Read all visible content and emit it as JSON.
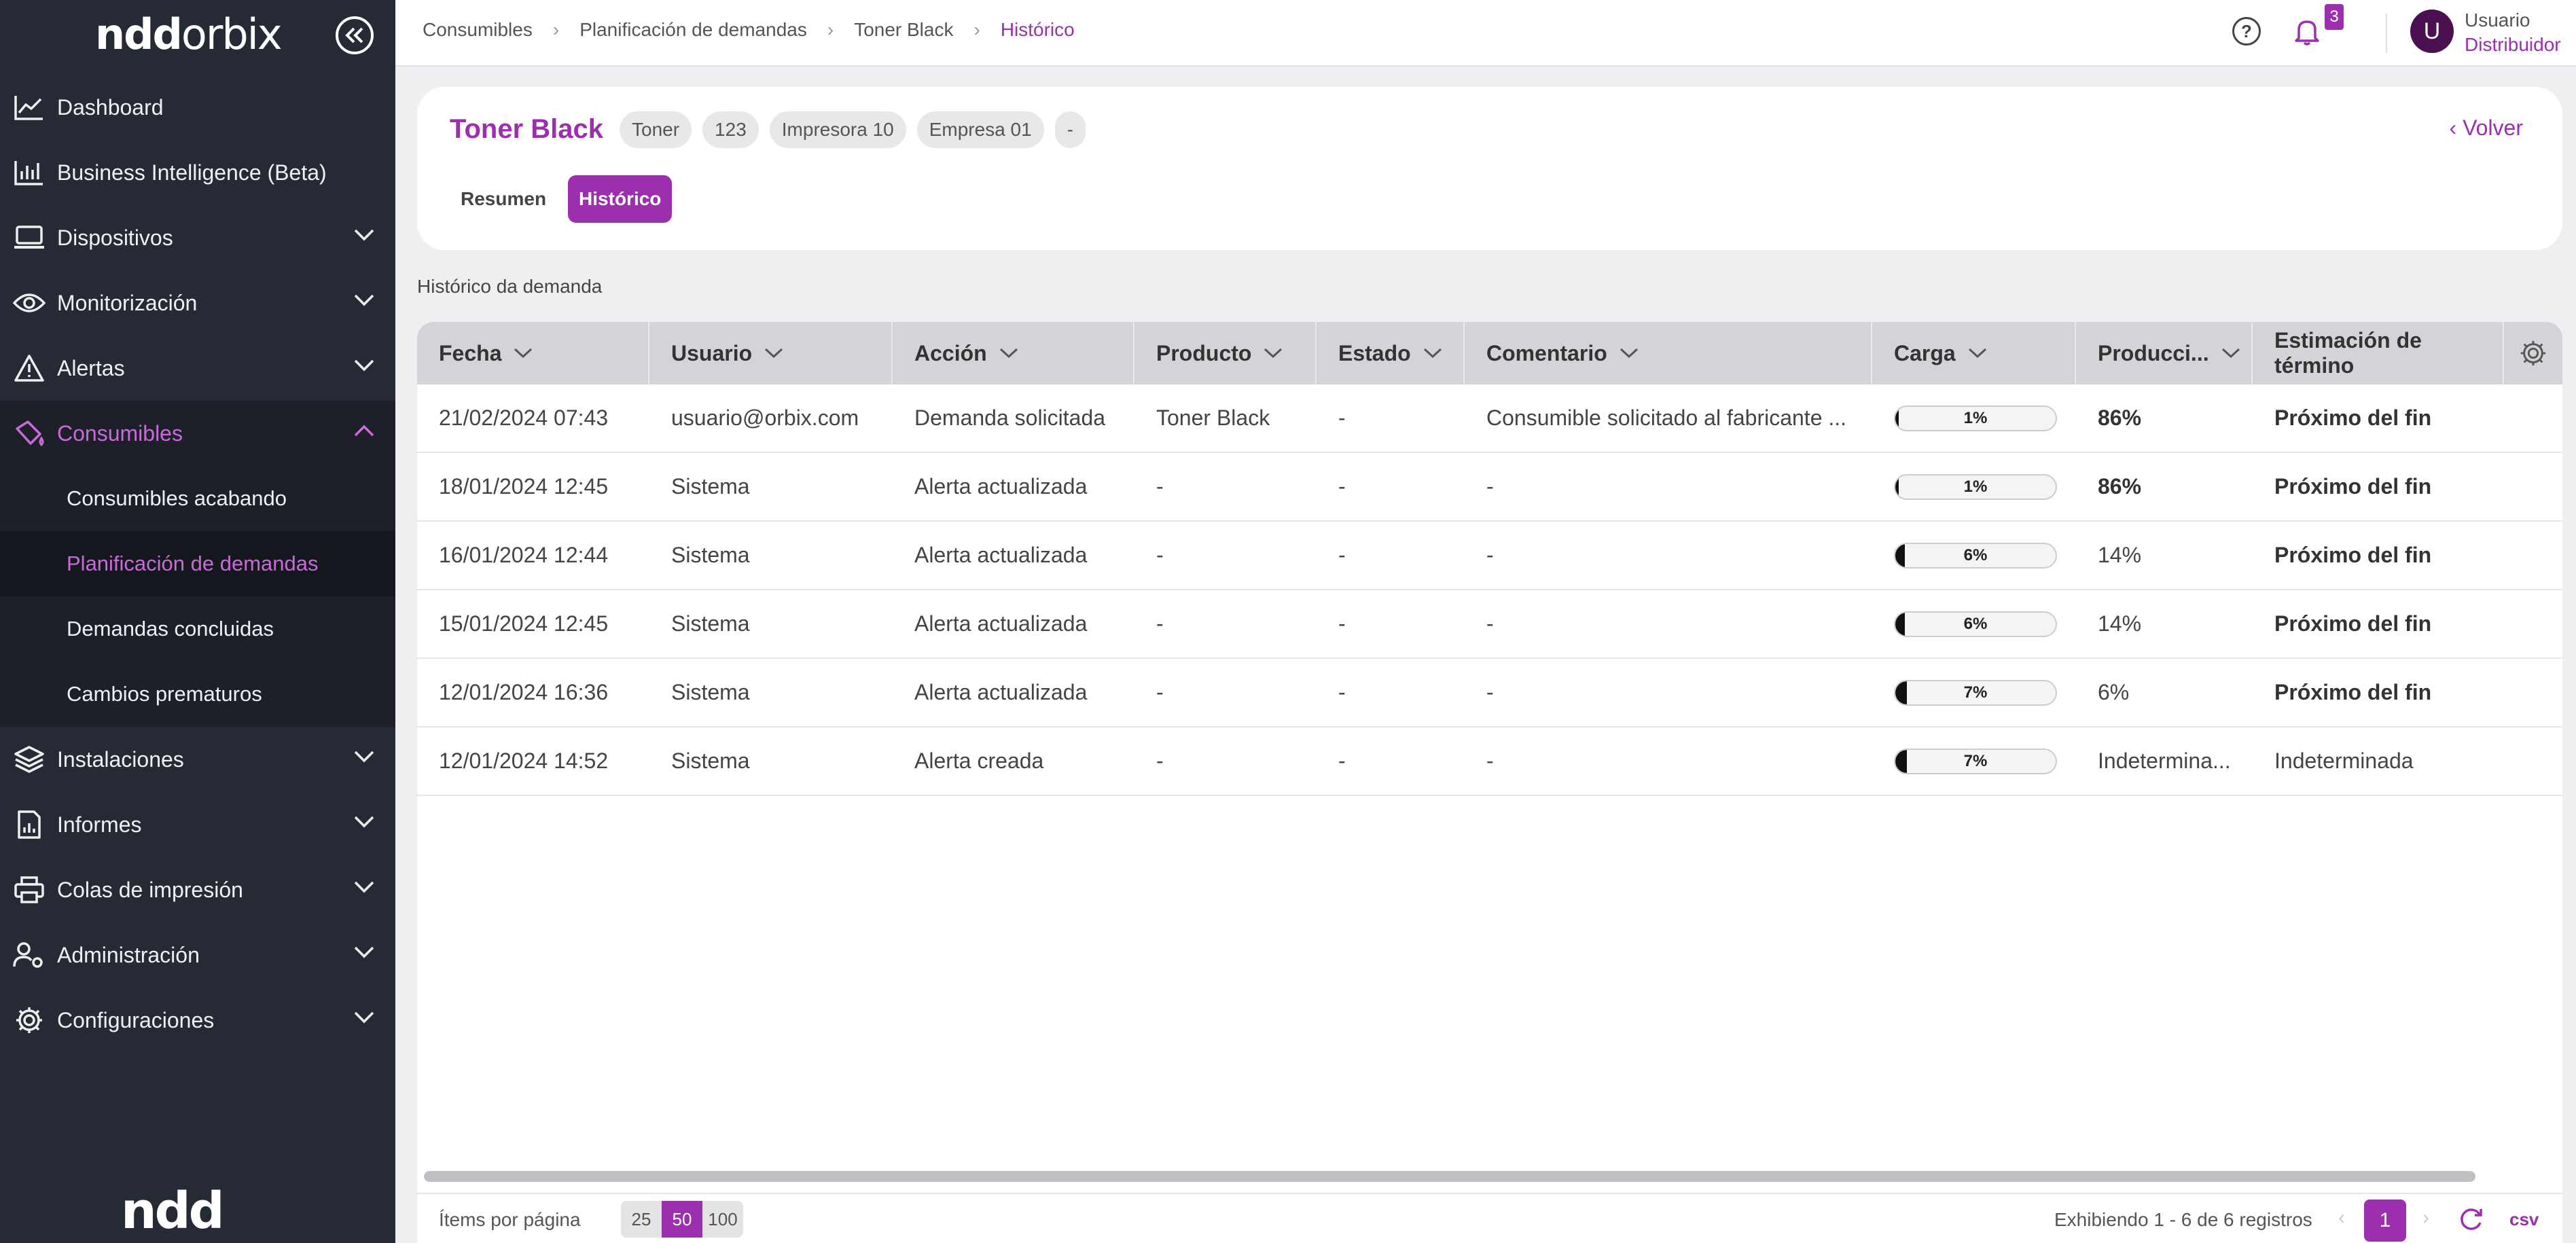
{
  "app": {
    "logo_text": "ndd",
    "logo_text2": "orbix",
    "bottom_logo": "ndd",
    "accent": "#9b2fae"
  },
  "sidebar": {
    "items": [
      {
        "label": "Dashboard",
        "icon": "chart-line-icon"
      },
      {
        "label": "Business Intelligence (Beta)",
        "icon": "bar-chart-icon"
      },
      {
        "label": "Dispositivos",
        "icon": "laptop-icon"
      },
      {
        "label": "Monitorización",
        "icon": "eye-icon"
      },
      {
        "label": "Alertas",
        "icon": "warning-icon"
      },
      {
        "label": "Consumibles",
        "icon": "ink-drop-icon"
      },
      {
        "label": "Instalaciones",
        "icon": "layers-icon"
      },
      {
        "label": "Informes",
        "icon": "report-icon"
      },
      {
        "label": "Colas de impresión",
        "icon": "printer-icon"
      },
      {
        "label": "Administración",
        "icon": "users-gear-icon"
      },
      {
        "label": "Configuraciones",
        "icon": "gear-icon"
      }
    ],
    "sub_items": [
      {
        "label": "Consumibles acabando"
      },
      {
        "label": "Planificación de demandas"
      },
      {
        "label": "Demandas concluidas"
      },
      {
        "label": "Cambios prematuros"
      }
    ]
  },
  "topbar": {
    "breadcrumb": [
      "Consumibles",
      "Planificación de demandas",
      "Toner Black",
      "Histórico"
    ],
    "notifications_count": "3",
    "avatar_letter": "U",
    "user_name": "Usuario",
    "user_role": "Distribuidor"
  },
  "header": {
    "title": "Toner Black",
    "chips": [
      "Toner",
      "123",
      "Impresora 10",
      "Empresa 01",
      "-"
    ],
    "back_label": "Volver",
    "tabs": [
      "Resumen",
      "Histórico"
    ]
  },
  "section_label": "Histórico da demanda",
  "table": {
    "columns": [
      "Fecha",
      "Usuario",
      "Acción",
      "Producto",
      "Estado",
      "Comentario",
      "Carga",
      "Producci...",
      "Estimación de término"
    ],
    "rows": [
      {
        "fecha": "21/02/2024 07:43",
        "usuario": "usuario@orbix.com",
        "accion": "Demanda solicitada",
        "producto": "Toner Black",
        "estado": "-",
        "comentario": "Consumible solicitado al fabricante ...",
        "carga": 1,
        "carga_label": "1%",
        "produccion": "86%",
        "produccion_bold": true,
        "estimacion": "Próximo del fin",
        "estimacion_bold": true
      },
      {
        "fecha": "18/01/2024 12:45",
        "usuario": "Sistema",
        "accion": "Alerta actualizada",
        "producto": "-",
        "estado": "-",
        "comentario": "-",
        "carga": 1,
        "carga_label": "1%",
        "produccion": "86%",
        "produccion_bold": true,
        "estimacion": "Próximo del fin",
        "estimacion_bold": true
      },
      {
        "fecha": "16/01/2024 12:44",
        "usuario": "Sistema",
        "accion": "Alerta actualizada",
        "producto": "-",
        "estado": "-",
        "comentario": "-",
        "carga": 6,
        "carga_label": "6%",
        "produccion": "14%",
        "produccion_bold": false,
        "estimacion": "Próximo del fin",
        "estimacion_bold": true
      },
      {
        "fecha": "15/01/2024 12:45",
        "usuario": "Sistema",
        "accion": "Alerta actualizada",
        "producto": "-",
        "estado": "-",
        "comentario": "-",
        "carga": 6,
        "carga_label": "6%",
        "produccion": "14%",
        "produccion_bold": false,
        "estimacion": "Próximo del fin",
        "estimacion_bold": true
      },
      {
        "fecha": "12/01/2024 16:36",
        "usuario": "Sistema",
        "accion": "Alerta actualizada",
        "producto": "-",
        "estado": "-",
        "comentario": "-",
        "carga": 7,
        "carga_label": "7%",
        "produccion": "6%",
        "produccion_bold": false,
        "estimacion": "Próximo del fin",
        "estimacion_bold": true
      },
      {
        "fecha": "12/01/2024 14:52",
        "usuario": "Sistema",
        "accion": "Alerta creada",
        "producto": "-",
        "estado": "-",
        "comentario": "-",
        "carga": 7,
        "carga_label": "7%",
        "produccion": "Indetermina...",
        "produccion_bold": false,
        "estimacion": "Indeterminada",
        "estimacion_bold": false
      }
    ]
  },
  "footer": {
    "items_label": "Ítems por página",
    "page_sizes": [
      "25",
      "50",
      "100"
    ],
    "showing": "Exhibiendo  1 - 6 de 6 registros",
    "current_page": "1",
    "csv_label": "csv"
  }
}
